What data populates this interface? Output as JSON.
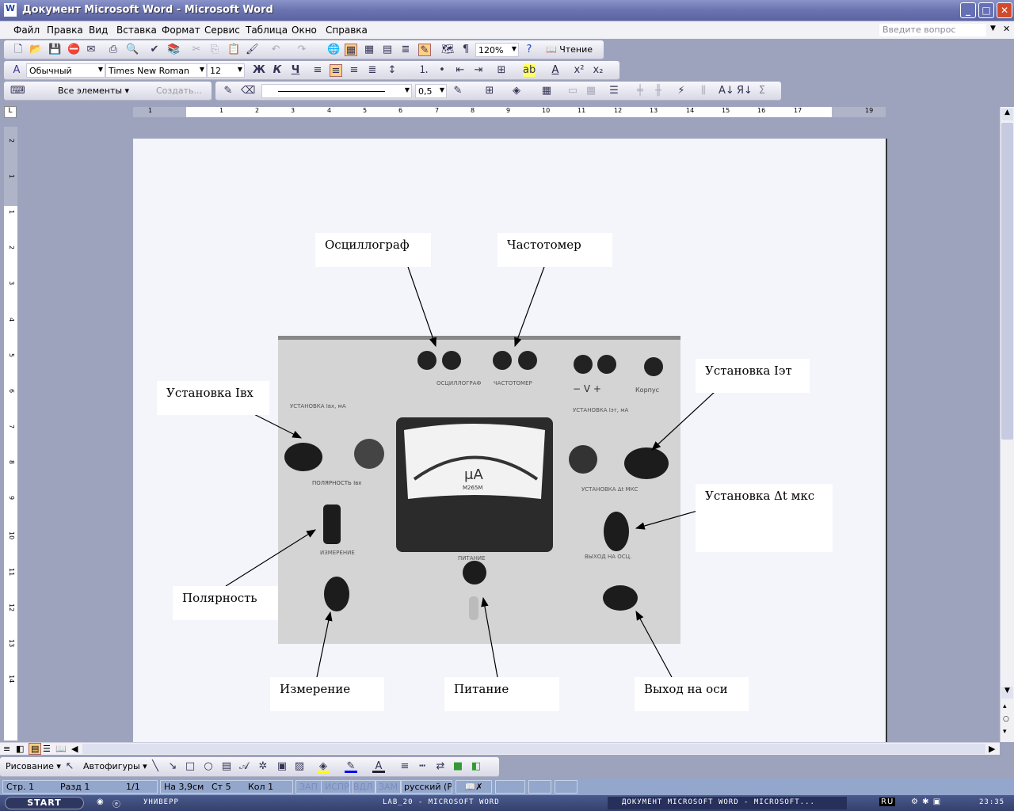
{
  "window": {
    "title": "Документ Microsoft Word - Microsoft Word",
    "minimize": "_",
    "maximize": "□",
    "close": "✕"
  },
  "menu": {
    "items": [
      "Файл",
      "Правка",
      "Вид",
      "Вставка",
      "Формат",
      "Сервис",
      "Таблица",
      "Окно",
      "Справка"
    ],
    "ask_placeholder": "Введите вопрос",
    "close_doc": "✕"
  },
  "toolbar_standard": {
    "zoom": "120%",
    "reading": "Чтение"
  },
  "toolbar_format": {
    "style": "Обычный",
    "font": "Times New Roman",
    "size": "12",
    "bold": "Ж",
    "italic": "К",
    "underline": "Ч"
  },
  "toolbar_tables": {
    "elements": "Все элементы",
    "create": "Создать...",
    "line_weight": "0,5",
    "sum": "Σ"
  },
  "ruler": {
    "h_ticks": [
      "1",
      "1",
      "2",
      "3",
      "4",
      "5",
      "6",
      "7",
      "8",
      "9",
      "10",
      "11",
      "12",
      "13",
      "14",
      "15",
      "16",
      "17",
      "19"
    ],
    "v_ticks": [
      "2",
      "1",
      "1",
      "2",
      "3",
      "4",
      "5",
      "6",
      "7",
      "8",
      "9",
      "10",
      "11",
      "12",
      "13",
      "14"
    ]
  },
  "document": {
    "callouts": {
      "osc": "Осциллограф",
      "freq": "Частотомер",
      "iin": "Установка Iвх",
      "iet": "Установка Iэт",
      "dt": "Установка Δt мкс",
      "pol": "Полярность",
      "meas": "Измерение",
      "power": "Питание",
      "out": "Выход на оси"
    },
    "photo": {
      "meter_unit": "μA",
      "meter_model": "М265М",
      "jack_osc": "ОСЦИЛЛОГРАФ",
      "jack_freq": "ЧАСТОТОМЕР",
      "volt": "− V +",
      "case": "Корпус",
      "iin_label": "УСТАНОВКА Iвх, мА",
      "iet_label": "УСТАНОВКА Iэт, мА",
      "dt_label": "УСТАНОВКА Δt МКС",
      "pol_label": "ПОЛЯРНОСТЬ Iвх",
      "meas_label": "ИЗМЕРЕНИЕ",
      "power_label": "ПИТАНИЕ",
      "out_label": "ВЫХОД НА ОСЦ."
    }
  },
  "drawing": {
    "draw": "Рисование",
    "autoshapes": "Автофигуры"
  },
  "status": {
    "page": "Стр. 1",
    "section": "Разд 1",
    "pages": "1/1",
    "at": "На 3,9см",
    "line": "Ст 5",
    "col": "Кол 1",
    "rec": "ЗАП",
    "trk": "ИСПР",
    "ext": "ВДЛ",
    "ovr": "ЗАМ",
    "lang": "русский (Ро"
  },
  "taskbar": {
    "start": "start",
    "tasks": [
      "универр",
      "lab_20 - Microsoft Word",
      "Документ Microsoft Word - Microsoft..."
    ],
    "tray_lang": "RU",
    "clock": "23:35"
  },
  "colors": {
    "title": "#6b73b0",
    "highlight": "#ffcf83",
    "status": "#93a6cc"
  }
}
